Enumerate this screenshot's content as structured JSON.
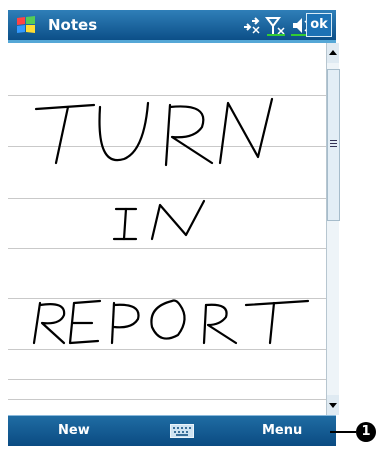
{
  "titlebar": {
    "title": "Notes",
    "ok_label": "ok"
  },
  "status_icons": [
    "connectivity-icon",
    "signal-icon",
    "volume-icon"
  ],
  "note": {
    "handwriting": [
      "TURN",
      "IN",
      "REPORT"
    ]
  },
  "softkeys": {
    "left": "New",
    "right": "Menu"
  },
  "callout": {
    "number": "1"
  },
  "colors": {
    "title_bar": "#0c4f88",
    "bottom_bar": "#0b4b82",
    "ink": "#000000"
  }
}
